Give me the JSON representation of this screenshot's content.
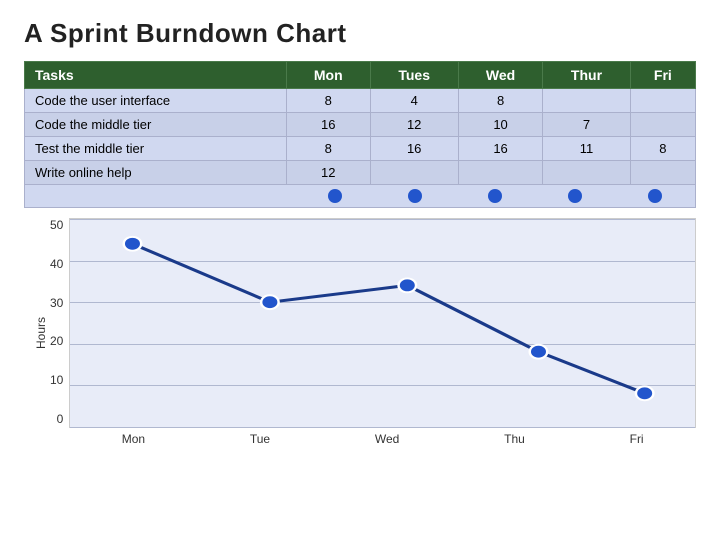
{
  "page": {
    "title": "A Sprint Burndown Chart"
  },
  "table": {
    "headers": [
      "Tasks",
      "Mon",
      "Tues",
      "Wed",
      "Thur",
      "Fri"
    ],
    "rows": [
      [
        "Code the user interface",
        "8",
        "4",
        "8",
        "",
        ""
      ],
      [
        "Code the middle tier",
        "16",
        "12",
        "10",
        "7",
        ""
      ],
      [
        "Test the middle tier",
        "8",
        "16",
        "16",
        "11",
        "8"
      ],
      [
        "Write online help",
        "12",
        "",
        "",
        "",
        ""
      ]
    ]
  },
  "chart": {
    "y_labels": [
      "50",
      "40",
      "30",
      "20",
      "10",
      "0"
    ],
    "x_labels": [
      "Mon",
      "Tue",
      "Wed",
      "Thu",
      "Fri"
    ],
    "y_axis_label": "Hours",
    "data_points": [
      {
        "label": "Mon",
        "value": 44,
        "x_pct": 10,
        "y_pct": 12
      },
      {
        "label": "Tue",
        "value": 30,
        "x_pct": 32,
        "y_pct": 40
      },
      {
        "label": "Wed",
        "value": 34,
        "x_pct": 54,
        "y_pct": 32
      },
      {
        "label": "Thu",
        "value": 18,
        "x_pct": 75,
        "y_pct": 64
      },
      {
        "label": "Fri",
        "value": 8,
        "x_pct": 90,
        "y_pct": 84
      }
    ]
  },
  "dots": {
    "count": 5,
    "color": "#2255cc"
  }
}
